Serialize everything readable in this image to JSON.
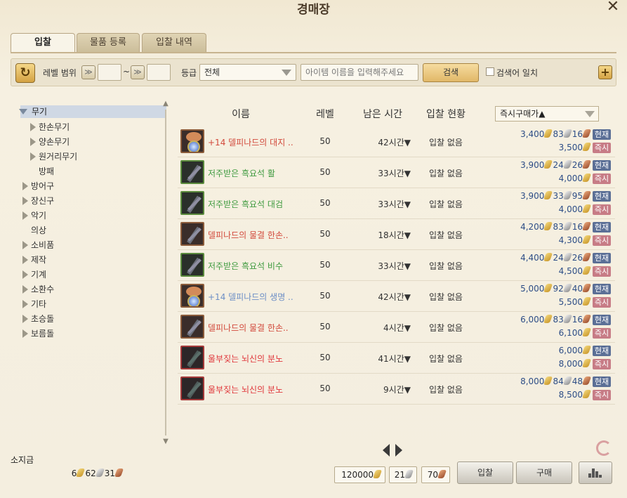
{
  "window": {
    "title": "경매장",
    "close_glyph": "✕"
  },
  "tabs": [
    {
      "label": "입찰",
      "active": true
    },
    {
      "label": "물품 등록",
      "active": false
    },
    {
      "label": "입찰 내역",
      "active": false
    }
  ],
  "toolbar": {
    "refresh_glyph": "↻",
    "level_range_label": "레벨 범위",
    "range_sep": "~",
    "level_min": "",
    "level_max": "",
    "grade_label": "등급",
    "grade_value": "전체",
    "search_placeholder": "아이템 이름을 입력해주세요",
    "search_button": "검색",
    "exact_match_label": "검색어 일치",
    "plus_glyph": "+"
  },
  "categories": [
    {
      "label": "무기",
      "level": 0,
      "expanded": true,
      "selected": true,
      "arrow": true
    },
    {
      "label": "한손무기",
      "level": 1,
      "arrow": true
    },
    {
      "label": "양손무기",
      "level": 1,
      "arrow": true
    },
    {
      "label": "원거리무기",
      "level": 1,
      "arrow": true
    },
    {
      "label": "방패",
      "level": 1,
      "arrow": false
    },
    {
      "label": "방어구",
      "level": 0,
      "arrow": true
    },
    {
      "label": "장신구",
      "level": 0,
      "arrow": true
    },
    {
      "label": "악기",
      "level": 0,
      "arrow": true
    },
    {
      "label": "의상",
      "level": 0,
      "arrow": false
    },
    {
      "label": "소비품",
      "level": 0,
      "arrow": true
    },
    {
      "label": "제작",
      "level": 0,
      "arrow": true
    },
    {
      "label": "기계",
      "level": 0,
      "arrow": true
    },
    {
      "label": "소환수",
      "level": 0,
      "arrow": true
    },
    {
      "label": "기타",
      "level": 0,
      "arrow": true
    },
    {
      "label": "초승돌",
      "level": 0,
      "arrow": true
    },
    {
      "label": "보름돌",
      "level": 0,
      "arrow": true
    }
  ],
  "table": {
    "headers": {
      "name": "이름",
      "level": "레벨",
      "time_left": "남은 시간",
      "bid_status": "입찰 현황"
    },
    "sort_value": "즉시구매가▲",
    "tag_current": "현재",
    "tag_instant": "즉시",
    "rows": [
      {
        "name": "+14 델피나드의 대지 ..",
        "color": "red",
        "icon": "doll",
        "frame": "brown",
        "level": "50",
        "time": "42시간▼",
        "status": "입찰 없음",
        "current": {
          "gold": "3,400",
          "silver": "83",
          "copper": "16"
        },
        "instant": {
          "gold": "3,500"
        }
      },
      {
        "name": "저주받은 흑요석 활",
        "color": "green",
        "icon": "sword",
        "frame": "green",
        "level": "50",
        "time": "33시간▼",
        "status": "입찰 없음",
        "current": {
          "gold": "3,900",
          "silver": "24",
          "copper": "26"
        },
        "instant": {
          "gold": "4,000"
        }
      },
      {
        "name": "저주받은 흑요석 대검",
        "color": "green",
        "icon": "sword",
        "frame": "green",
        "level": "50",
        "time": "33시간▼",
        "status": "입찰 없음",
        "current": {
          "gold": "3,900",
          "silver": "33",
          "copper": "95"
        },
        "instant": {
          "gold": "4,000"
        }
      },
      {
        "name": "델피나드의 물결 한손..",
        "color": "red",
        "icon": "sword",
        "frame": "brown",
        "level": "50",
        "time": "18시간▼",
        "status": "입찰 없음",
        "current": {
          "gold": "4,200",
          "silver": "83",
          "copper": "16"
        },
        "instant": {
          "gold": "4,300"
        }
      },
      {
        "name": "저주받은 흑요석 비수",
        "color": "green",
        "icon": "sword",
        "frame": "green",
        "level": "50",
        "time": "33시간▼",
        "status": "입찰 없음",
        "current": {
          "gold": "4,400",
          "silver": "24",
          "copper": "26"
        },
        "instant": {
          "gold": "4,500"
        }
      },
      {
        "name": "+14 델피나드의 생명 ..",
        "color": "blue",
        "icon": "doll",
        "frame": "brown",
        "level": "50",
        "time": "42시간▼",
        "status": "입찰 없음",
        "current": {
          "gold": "5,000",
          "silver": "92",
          "copper": "40"
        },
        "instant": {
          "gold": "5,500"
        }
      },
      {
        "name": "델피나드의 물결 한손..",
        "color": "red",
        "icon": "sword",
        "frame": "brown",
        "level": "50",
        "time": "4시간▼",
        "status": "입찰 없음",
        "current": {
          "gold": "6,000",
          "silver": "83",
          "copper": "16"
        },
        "instant": {
          "gold": "6,100"
        }
      },
      {
        "name": "울부짖는 뇌신의 분노",
        "color": "brightred",
        "icon": "mace",
        "frame": "red",
        "level": "50",
        "time": "41시간▼",
        "status": "입찰 없음",
        "current": {
          "gold": "6,000"
        },
        "instant": {
          "gold": "8,000"
        }
      },
      {
        "name": "울부짖는 뇌신의 분노",
        "color": "brightred",
        "icon": "mace",
        "frame": "red",
        "level": "50",
        "time": "9시간▼",
        "status": "입찰 없음",
        "current": {
          "gold": "8,000",
          "silver": "84",
          "copper": "48"
        },
        "instant": {
          "gold": "8,500"
        }
      }
    ]
  },
  "footer": {
    "money_label": "소지금",
    "money": {
      "gold": "6",
      "silver": "62",
      "copper": "31"
    },
    "bid_gold": "120000",
    "bid_silver": "21",
    "bid_copper": "70",
    "bid_button": "입찰",
    "buy_button": "구매"
  },
  "colors": {
    "accent_gold": "#e1b868",
    "tag_current": "#5b6f96",
    "tag_instant": "#c77c86",
    "price_text": "#2d4d86"
  }
}
